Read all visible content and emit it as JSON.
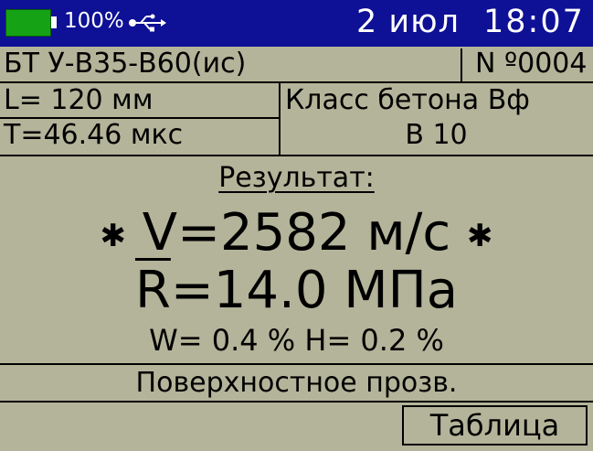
{
  "status_bar": {
    "battery_percent": "100%",
    "battery_icon": "battery-icon",
    "usb_icon": "usb-icon",
    "date": "2 июл",
    "time": "18:07",
    "background_color": "#0e1095",
    "battery_color": "#15a315"
  },
  "header": {
    "mode": "БТ У-В35-В60(ис)",
    "record_number": "N º0004"
  },
  "params": {
    "length": "L= 120 мм",
    "time": "T=46.46 мкс",
    "class_label": "Класс бетона Вф",
    "class_value": "В 10"
  },
  "result": {
    "title": "Результат:",
    "velocity": "V=2582 м/с",
    "velocity_marker": "✱",
    "strength_symbol": "R",
    "strength_value": "=14.0 МПа",
    "humidity": "W= 0.4 %  H= 0.2 %"
  },
  "footer": {
    "note": "Поверхностное прозв.",
    "table_button": "Таблица"
  },
  "colors": {
    "screen_background": "#b4b49a",
    "text": "#000000"
  }
}
